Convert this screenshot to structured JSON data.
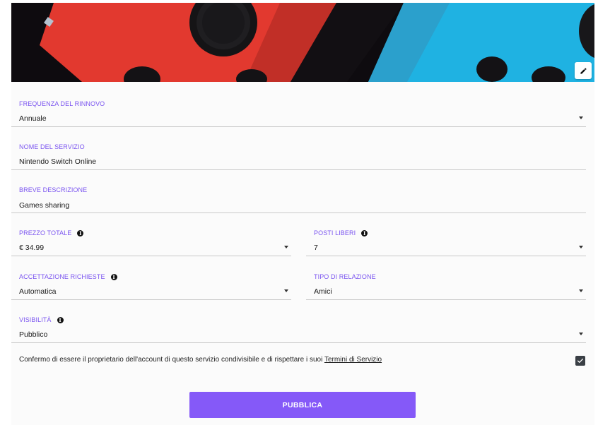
{
  "cover": {
    "edit_icon": "pencil-icon"
  },
  "form": {
    "frequency": {
      "label": "FREQUENZA DEL RINNOVO",
      "value": "Annuale"
    },
    "service_name": {
      "label": "NOME DEL SERVIZIO",
      "value": "Nintendo Switch Online"
    },
    "description": {
      "label": "BREVE DESCRIZIONE",
      "value": "Games sharing"
    },
    "total_price": {
      "label": "PREZZO TOTALE",
      "value": "€ 34.99"
    },
    "free_slots": {
      "label": "POSTI LIBERI",
      "value": "7"
    },
    "acceptance": {
      "label": "ACCETTAZIONE RICHIESTE",
      "value": "Automatica"
    },
    "relation": {
      "label": "TIPO DI RELAZIONE",
      "value": "Amici"
    },
    "visibility": {
      "label": "VISIBILITÀ",
      "value": "Pubblico"
    },
    "terms": {
      "text": "Confermo di essere il proprietario dell'account di questo servizio condivisibile e di rispettare i suoi ",
      "link": "Termini di Servizio",
      "checked": true
    },
    "publish_label": "PUBBLICA"
  },
  "colors": {
    "accent": "#8559f8",
    "label": "#7b55f0",
    "checkbox": "#3a3f45"
  }
}
